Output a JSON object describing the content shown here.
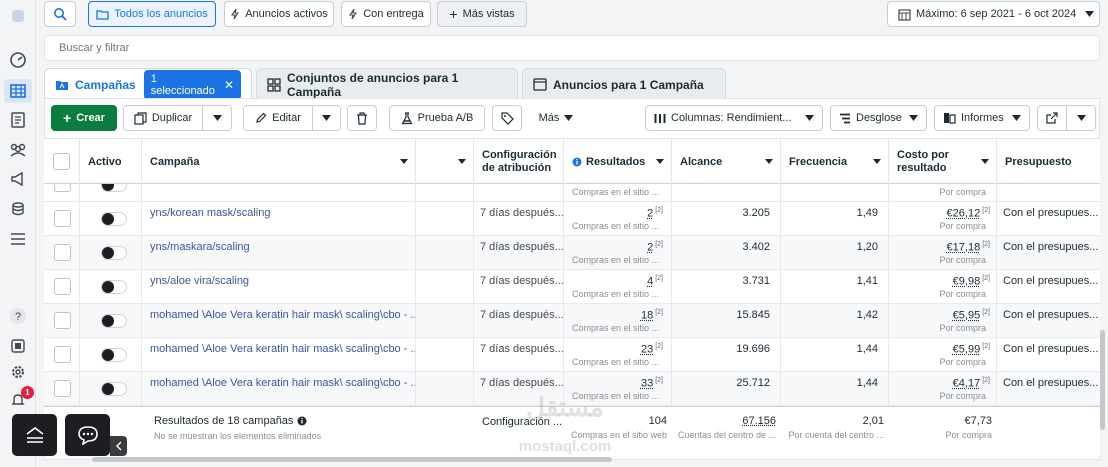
{
  "topbar": {
    "tabs": [
      "Todos los anuncios",
      "Anuncios activos",
      "Con entrega",
      "Más vistas"
    ],
    "date_range": "Máximo: 6 sep 2021 - 6 oct 2024"
  },
  "search": {
    "placeholder": "Buscar y filtrar"
  },
  "level_tabs": {
    "campaigns": "Campañas",
    "selected_badge": "1 seleccionado",
    "adsets": "Conjuntos de anuncios para 1 Campaña",
    "ads": "Anuncios para 1 Campaña"
  },
  "toolbar": {
    "create": "Crear",
    "duplicate": "Duplicar",
    "edit": "Editar",
    "ab_test": "Prueba A/B",
    "more": "Más",
    "columns": "Columnas: Rendimient...",
    "breakdown": "Desglose",
    "reports": "Informes"
  },
  "columns": {
    "active": "Activo",
    "campaign": "Campaña",
    "attribution": [
      "Configuración",
      "de atribución"
    ],
    "results": "Resultados",
    "reach": "Alcance",
    "frequency": "Frecuencia",
    "cost": [
      "Costo por",
      "resultado"
    ],
    "budget": "Presupuesto"
  },
  "partial_row": {
    "results_sub": "Compras en el sitio ...",
    "cost_sub": "Por compra"
  },
  "rows": [
    {
      "name": "yns/korean mask/scaling",
      "attribution": "7 días después...",
      "results": "2",
      "results_sub": "Compras en el sitio ...",
      "reach": "3.205",
      "frequency": "1,49",
      "cost": "€26,12",
      "cost_sub": "Por compra",
      "budget": "Con el presupues..."
    },
    {
      "name": "yns/maskara/scaling",
      "attribution": "7 días después...",
      "results": "2",
      "results_sub": "Compras en el sitio ...",
      "reach": "3.402",
      "frequency": "1,20",
      "cost": "€17,18",
      "cost_sub": "Por compra",
      "budget": "Con el presupues..."
    },
    {
      "name": "yns/aloe vira/scaling",
      "attribution": "7 días después...",
      "results": "4",
      "results_sub": "Compras en el sitio ...",
      "reach": "3.731",
      "frequency": "1,41",
      "cost": "€9,98",
      "cost_sub": "Por compra",
      "budget": "Con el presupues..."
    },
    {
      "name": "mohamed \\Aloe Vera keratin hair mask\\ scaling\\cbo - ...",
      "attribution": "7 días después...",
      "results": "18",
      "results_sub": "Compras en el sitio ...",
      "reach": "15.845",
      "frequency": "1,42",
      "cost": "€5,95",
      "cost_sub": "Por compra",
      "budget": "Con el presupues..."
    },
    {
      "name": "mohamed \\Aloe Vera keratin hair mask\\ scaling\\cbo - ...",
      "attribution": "7 días después...",
      "results": "23",
      "results_sub": "Compras en el sitio ...",
      "reach": "19.696",
      "frequency": "1,44",
      "cost": "€5,99",
      "cost_sub": "Por compra",
      "budget": "Con el presupues..."
    },
    {
      "name": "mohamed \\Aloe Vera keratin hair mask\\ scaling\\cbo - ...",
      "attribution": "7 días después...",
      "results": "33",
      "results_sub": "Compras en el sitio ...",
      "reach": "25.712",
      "frequency": "1,44",
      "cost": "€4,17",
      "cost_sub": "Por compra",
      "budget": "Con el presupues..."
    }
  ],
  "footer": {
    "title": "Resultados de 18 campañas",
    "subtitle": "No se muestran los elementos eliminados",
    "attribution": "Configuración ...",
    "results": "104",
    "results_sub": "Compras en el sitio web",
    "reach": "67.156",
    "reach_sub": "Cuentas del centro de ...",
    "frequency": "2,01",
    "frequency_sub": "Por cuenta del centro ...",
    "cost": "€7,73",
    "cost_sub": "Por compra"
  },
  "footnote_mark": "[2]",
  "notification_count": "1",
  "watermark": {
    "main": "مستقل",
    "sub": "mostaql.com"
  },
  "colors": {
    "primary": "#1b74e4",
    "create_button": "#0a7c3e",
    "link": "#385898"
  }
}
